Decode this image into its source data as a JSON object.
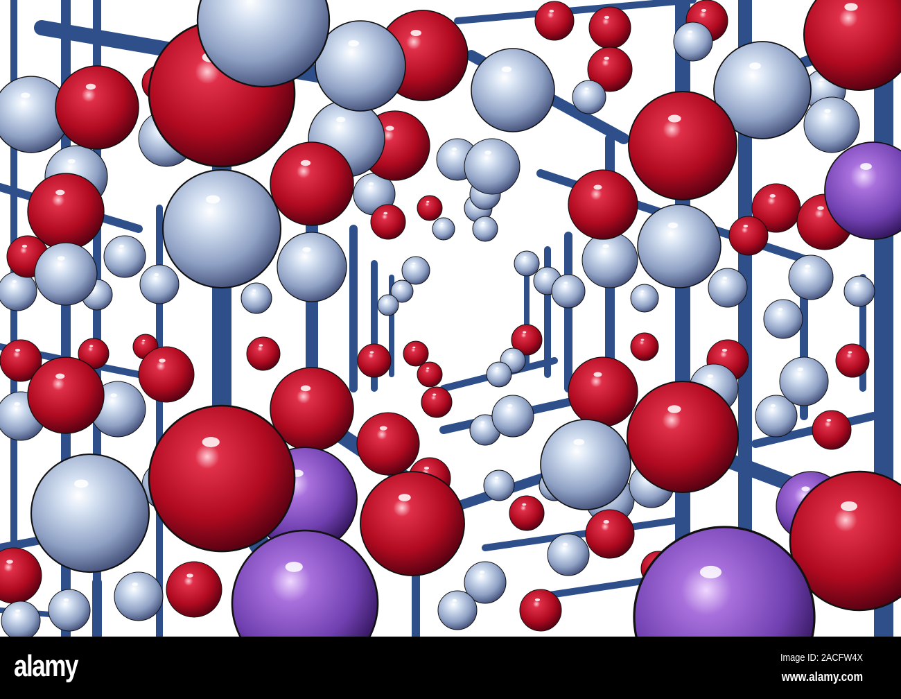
{
  "image": {
    "subject": "molecular lattice of spheres and rods",
    "colors": {
      "red": "#c0102a",
      "silver": "#b8c8e0",
      "purple": "#8a4fc0",
      "rod": "#2e4f8a",
      "background": "#ffffff"
    }
  },
  "watermark": {
    "logo": "alamy",
    "image_id": "Image ID: 2ACFW4X",
    "url": "www.alamy.com"
  }
}
